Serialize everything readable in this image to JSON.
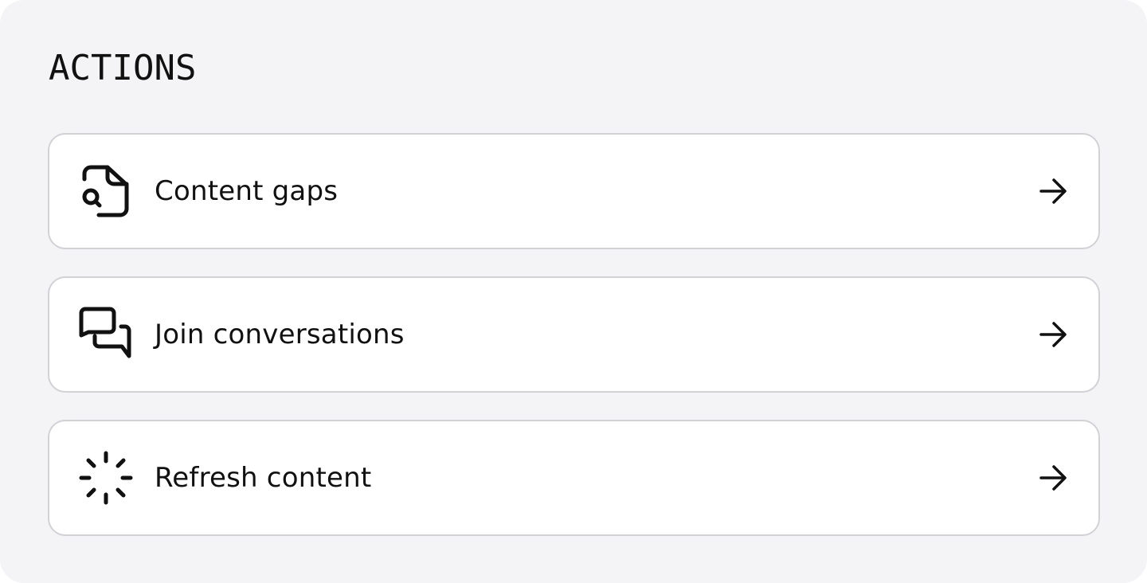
{
  "header": {
    "title": "ACTIONS"
  },
  "actions": [
    {
      "label": "Content gaps",
      "icon": "file-search-icon"
    },
    {
      "label": "Join conversations",
      "icon": "chat-bubbles-icon"
    },
    {
      "label": "Refresh content",
      "icon": "loading-spinner-icon"
    }
  ],
  "colors": {
    "panel_background": "#f4f3f6",
    "card_background": "#ffffff",
    "card_border": "#d2d1d5",
    "text": "#111111"
  }
}
